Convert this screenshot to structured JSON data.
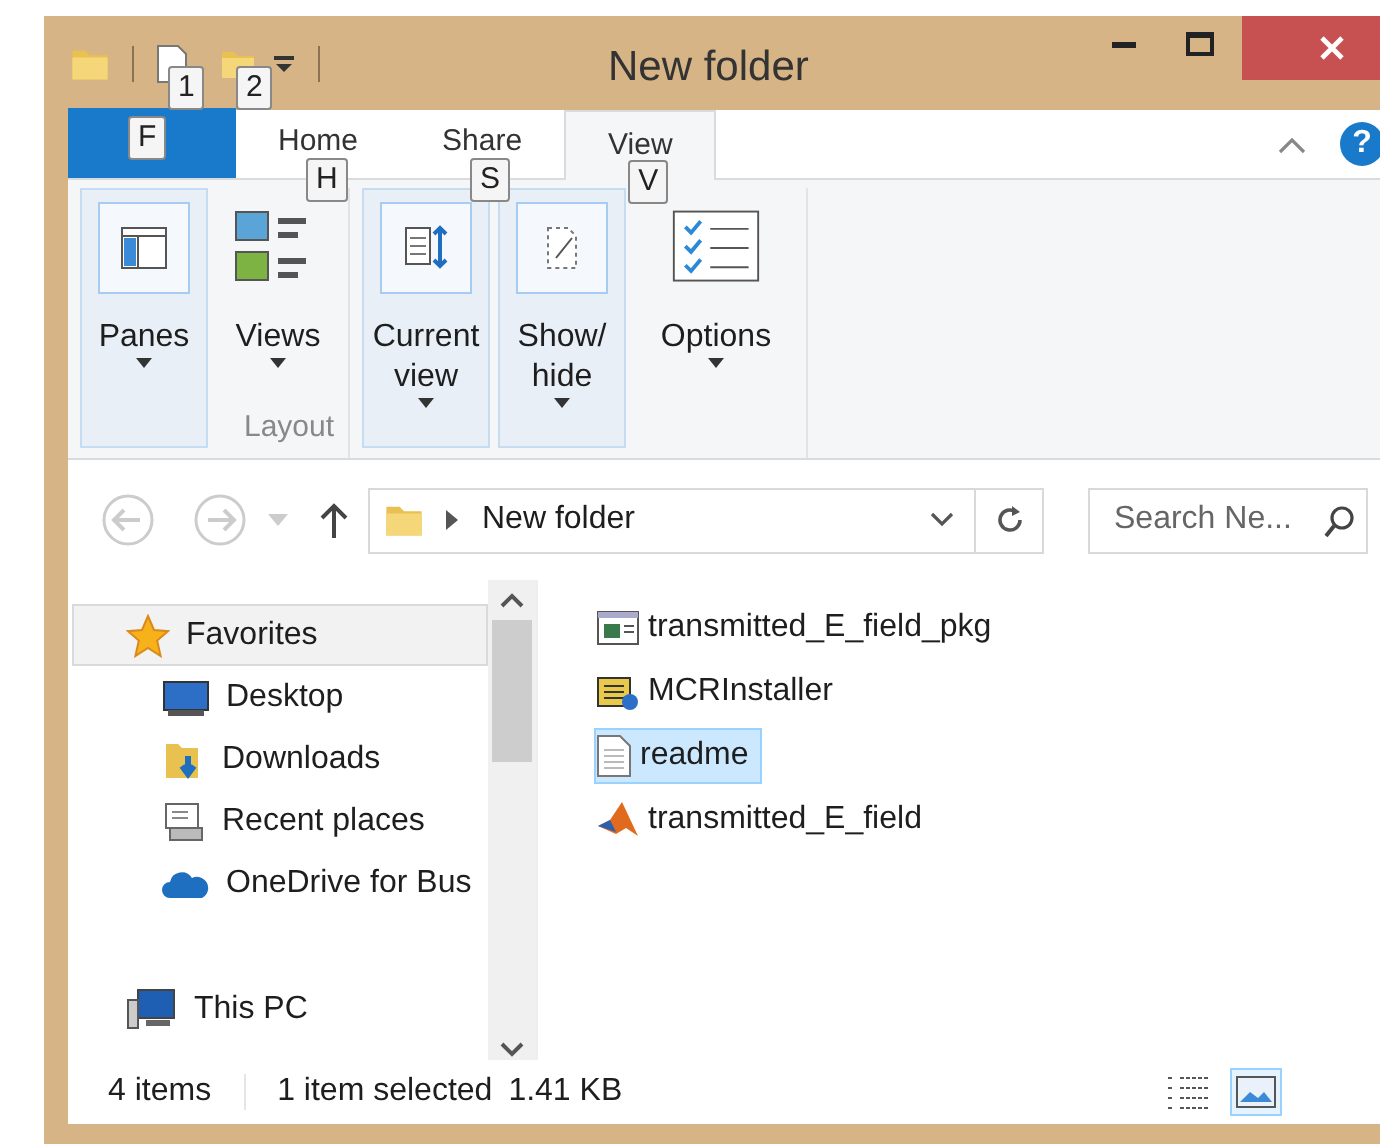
{
  "window": {
    "title": "New folder"
  },
  "quick_access_keys": [
    {
      "key": "1"
    },
    {
      "key": "2"
    }
  ],
  "tabs": [
    {
      "label": "Home",
      "selected": false,
      "key": "H"
    },
    {
      "label": "Share",
      "selected": false,
      "key": "S"
    },
    {
      "label": "View",
      "selected": true,
      "key": "V"
    }
  ],
  "file_tab": {
    "key": "F"
  },
  "help": "?",
  "ribbon": {
    "groups": [
      {
        "label": "Layout",
        "buttons": [
          {
            "kind": "panes",
            "label": "Panes",
            "highlighted": true
          },
          {
            "kind": "views",
            "label": "Views",
            "highlighted": false
          }
        ]
      },
      {
        "buttons": [
          {
            "kind": "current",
            "label": "Current view",
            "highlighted": true
          },
          {
            "kind": "showhide",
            "label": "Show/ hide",
            "highlighted": true
          },
          {
            "kind": "options",
            "label": "Options",
            "highlighted": false
          }
        ]
      }
    ]
  },
  "address": {
    "path": "New folder",
    "search_placeholder": "Search Ne..."
  },
  "nav_pane": [
    {
      "kind": "star",
      "label": "Favorites",
      "selected": true,
      "children": [
        {
          "kind": "desktop",
          "label": "Desktop",
          "selected": false
        },
        {
          "kind": "downloads",
          "label": "Downloads",
          "selected": false
        },
        {
          "kind": "recent",
          "label": "Recent places",
          "selected": false
        },
        {
          "kind": "cloud",
          "label": "OneDrive for Bus",
          "selected": false
        }
      ]
    },
    {
      "kind": "pc",
      "label": "This PC",
      "selected": false
    }
  ],
  "files": [
    {
      "kind": "app",
      "name": "transmitted_E_field_pkg",
      "selected": false
    },
    {
      "kind": "installer",
      "name": "MCRInstaller",
      "selected": false
    },
    {
      "kind": "text",
      "name": "readme",
      "selected": true
    },
    {
      "kind": "matlab",
      "name": "transmitted_E_field",
      "selected": false
    }
  ],
  "status_bar": {
    "count": "4 items",
    "selection": "1 item selected",
    "size": "1.41 KB"
  },
  "view_buttons": [
    {
      "kind": "details",
      "selected": false
    },
    {
      "kind": "large",
      "selected": true
    }
  ]
}
